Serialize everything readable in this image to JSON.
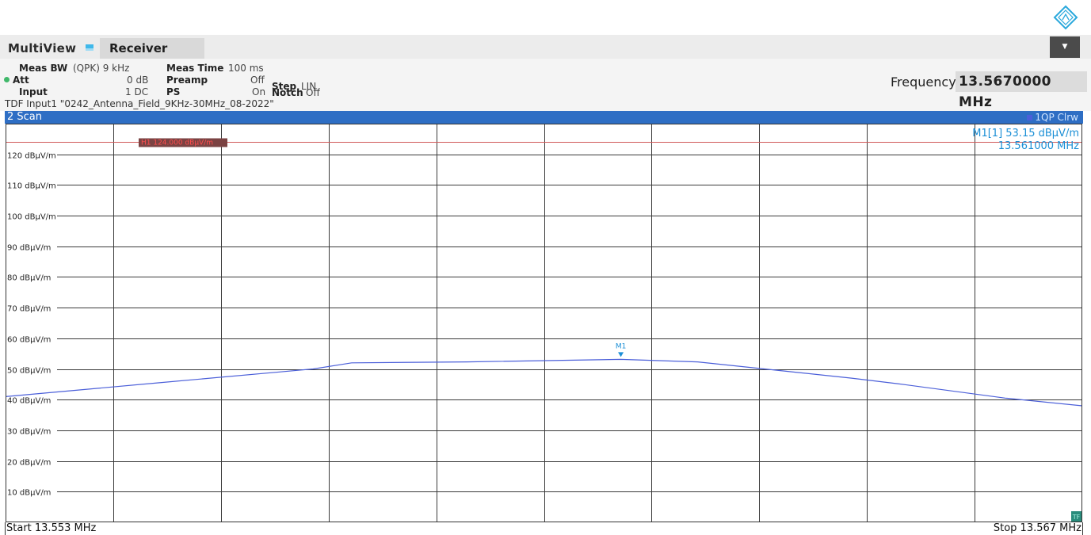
{
  "app": {
    "logo_icon": "rohde-schwarz-logo",
    "window_title": "MultiView",
    "active_tab": "Receiver",
    "menu_icon": "dropdown-arrow-icon"
  },
  "settings": {
    "meas_bw_label": "Meas BW",
    "meas_bw_value": "(QPK) 9 kHz",
    "meas_time_label": "Meas Time",
    "meas_time_value": "100 ms",
    "att_label": "Att",
    "att_value": "0 dB",
    "preamp_label": "Preamp",
    "preamp_value": "Off",
    "step_label": "Step",
    "step_value": "LIN",
    "input_label": "Input",
    "input_value": "1 DC",
    "ps_label": "PS",
    "ps_value": "On",
    "notch_label": "Notch",
    "notch_value": "Off",
    "tdf_text": "TDF Input1 \"0242_Antenna_Field_9KHz-30MHz_08-2022\""
  },
  "frequency": {
    "label": "Frequency",
    "value": "13.5670000 MHz"
  },
  "window": {
    "title": "2 Scan",
    "trace_label": "1QP Clrw",
    "trace_color": "#4b5fd9"
  },
  "marker": {
    "name": "M1",
    "readout_id": "M1[1]",
    "level": "53.15 dBµV/m",
    "freq": "13.561000 MHz",
    "color": "#1b8fd6"
  },
  "limit_line": {
    "label": "H1 124.000 dBµV/m",
    "value": 124,
    "color": "#c0393b"
  },
  "chart_data": {
    "type": "line",
    "xlim": [
      13.553,
      13.567
    ],
    "ylim": [
      0,
      130
    ],
    "y_ticks": [
      {
        "v": 120,
        "label": "120 dBµV/m"
      },
      {
        "v": 110,
        "label": "110 dBµV/m"
      },
      {
        "v": 100,
        "label": "100 dBµV/m"
      },
      {
        "v": 90,
        "label": "90 dBµV/m"
      },
      {
        "v": 80,
        "label": "80 dBµV/m"
      },
      {
        "v": 70,
        "label": "70 dBµV/m"
      },
      {
        "v": 60,
        "label": "60 dBµV/m"
      },
      {
        "v": 50,
        "label": "50 dBµV/m"
      },
      {
        "v": 40,
        "label": "40 dBµV/m"
      },
      {
        "v": 30,
        "label": "30 dBµV/m"
      },
      {
        "v": 20,
        "label": "20 dBµV/m"
      },
      {
        "v": 10,
        "label": "10 dBµV/m"
      }
    ],
    "x_divisions": 10,
    "grid": true,
    "series": [
      {
        "name": "1QP Clrw",
        "color": "#4b5fd9",
        "x": [
          13.553,
          13.555,
          13.557,
          13.5575,
          13.559,
          13.561,
          13.562,
          13.564,
          13.5646,
          13.566,
          13.567
        ],
        "y": [
          41.0,
          45.5,
          50.0,
          52.0,
          52.3,
          53.15,
          52.3,
          47.0,
          45.2,
          40.5,
          38.0
        ]
      }
    ],
    "start_label": "Start 13.553 MHz",
    "stop_label": "Stop 13.567 MHz",
    "corner_badge": "TF"
  }
}
